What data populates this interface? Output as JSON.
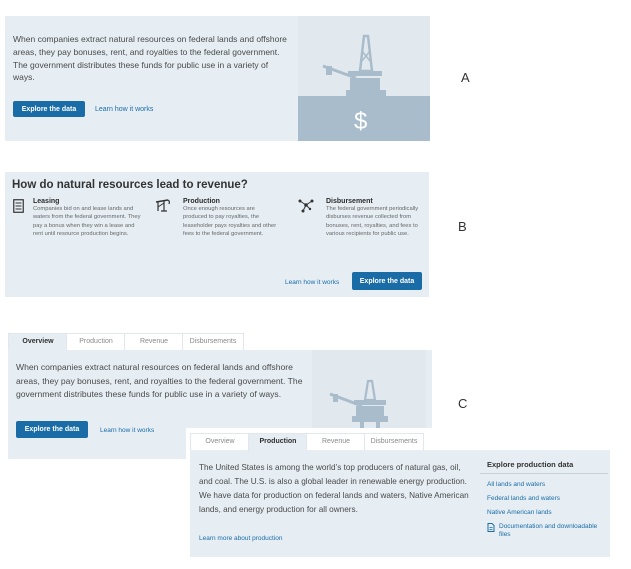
{
  "variantA": {
    "letter": "A",
    "paragraph": "When companies extract natural resources on federal lands and offshore areas, they pay bonuses, rent, and royalties to the federal government. The government distributes these funds for public use in a variety of ways.",
    "explore_button": "Explore the data",
    "learn_link": "Learn how it works"
  },
  "variantB": {
    "letter": "B",
    "heading": "How do natural resources lead to revenue?",
    "features": [
      {
        "title": "Leasing",
        "text": "Companies bid on and lease lands and waters from the federal government. They pay a bonus when they win a lease and rent until resource production begins."
      },
      {
        "title": "Production",
        "text": "Once enough resources are produced to pay royalties, the leaseholder pays royalties and other fees to the federal government."
      },
      {
        "title": "Disbursement",
        "text": "The federal government periodically disburses revenue collected from bonuses, rent, royalties, and fees to various recipients for public use."
      }
    ],
    "learn_link": "Learn how it works",
    "explore_button": "Explore the data"
  },
  "variantC": {
    "letter": "C",
    "tabs": [
      "Overview",
      "Production",
      "Revenue",
      "Disbursements"
    ],
    "overview": {
      "paragraph": "When companies extract natural resources on federal lands and offshore areas, they pay bonuses, rent, and royalties to the federal government. The government distributes these funds for public use in a variety of ways.",
      "explore_button": "Explore the data",
      "learn_link": "Learn how it works"
    },
    "production": {
      "paragraph": "The United States is among the world’s top producers of natural gas, oil, and coal. The U.S. is also a global leader in renewable energy production. We have data for production on federal lands and waters, Native American lands, and energy production for all owners.",
      "learn_link": "Learn more about production",
      "sidebar_title": "Explore production data",
      "sidebar_links": [
        "All lands and waters",
        "Federal lands and waters",
        "Native American lands",
        "Documentation and downloadable files"
      ]
    }
  },
  "colors": {
    "panel": "#e6eef4",
    "accent": "#1a6ca7",
    "illustration": "#a9bccb"
  },
  "icons": [
    "oil-rig-icon",
    "dollar-icon",
    "document-icon",
    "pump-icon",
    "distribution-icon",
    "file-icon"
  ]
}
